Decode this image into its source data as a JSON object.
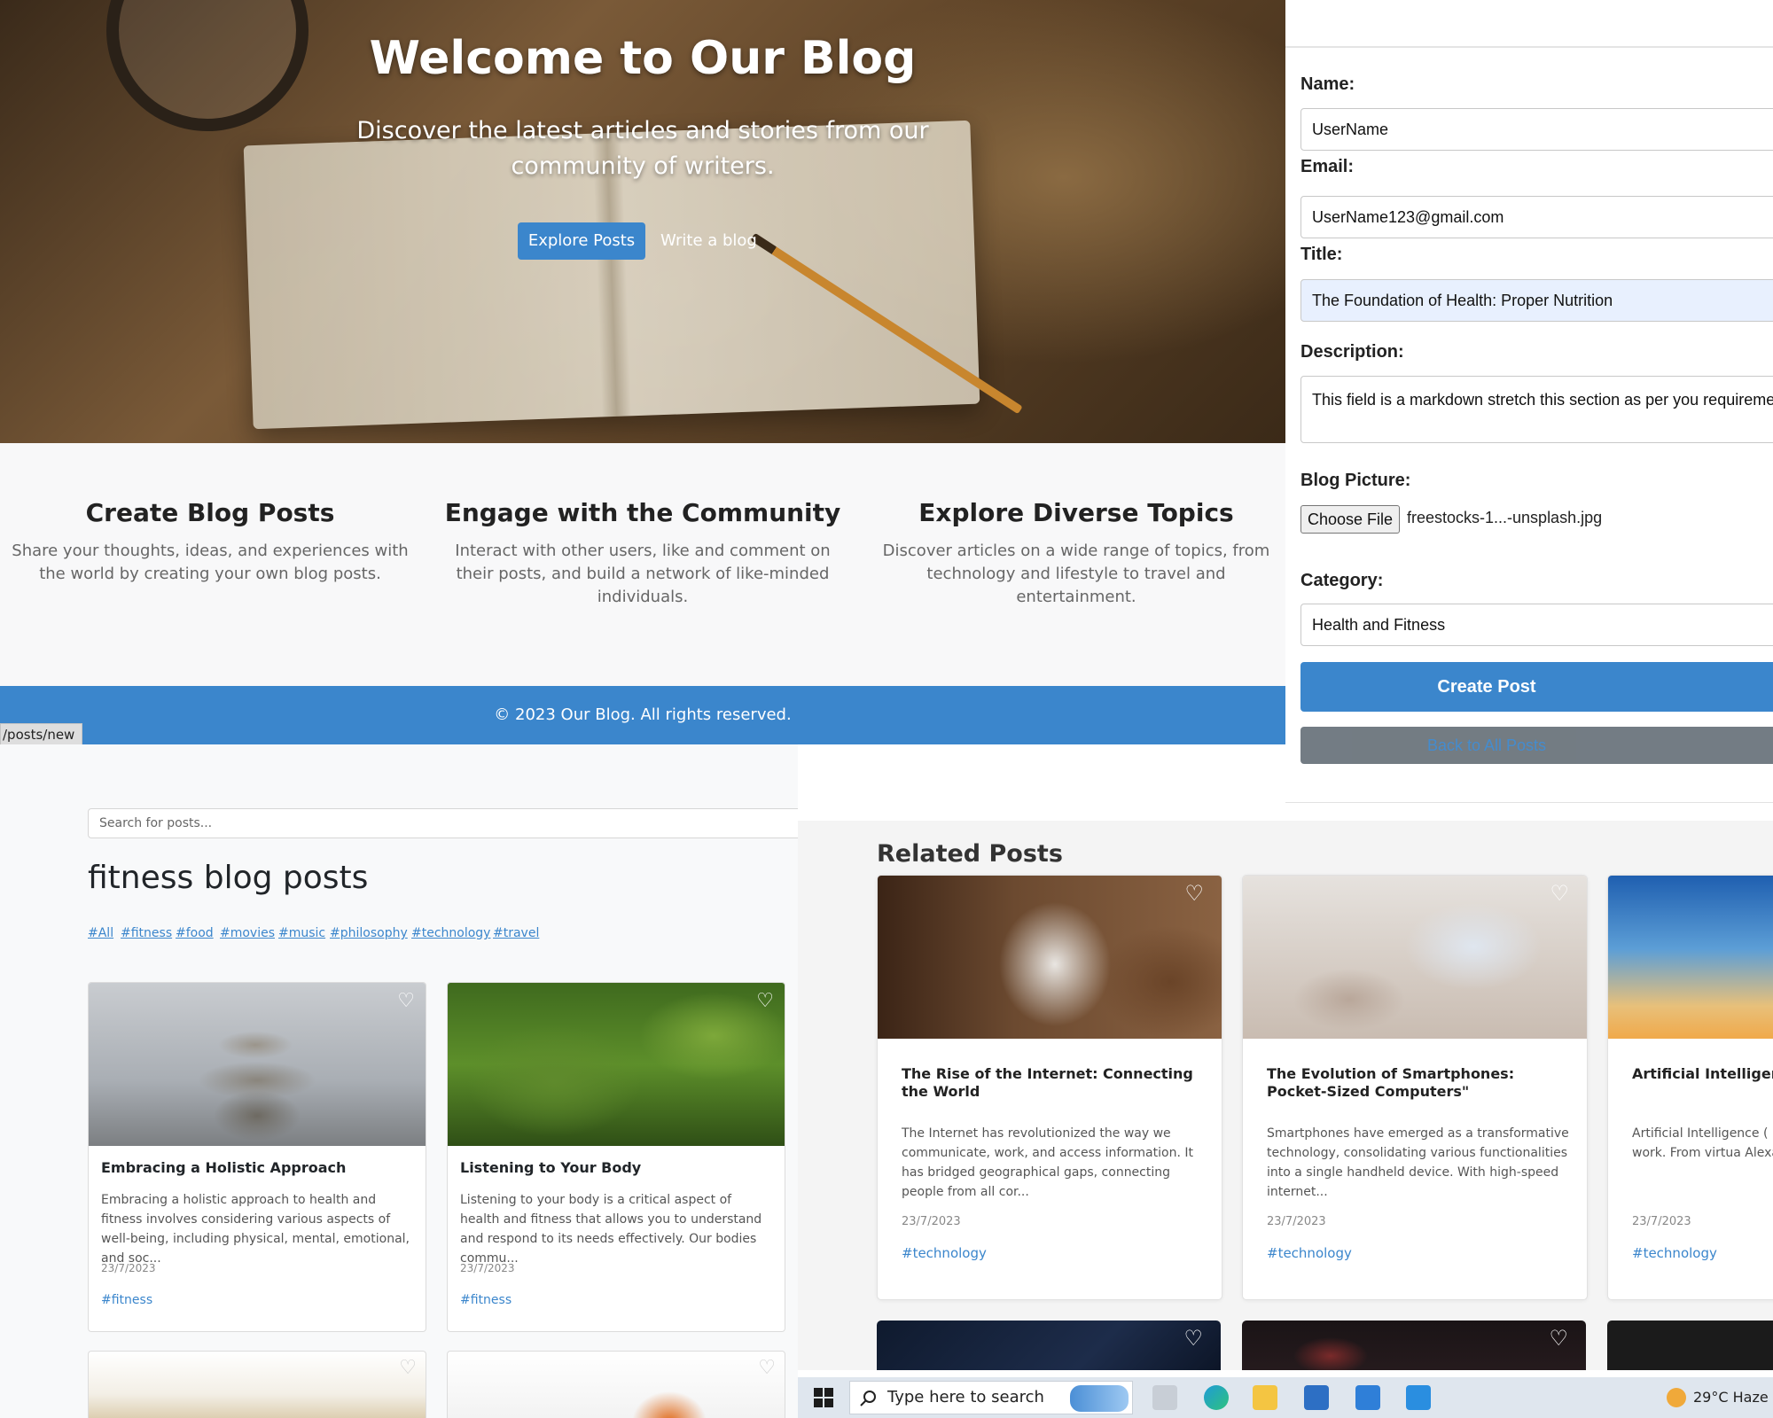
{
  "hero": {
    "title": "Welcome to Our Blog",
    "subtitle": "Discover the latest articles and stories from our community of writers.",
    "explore_btn": "Explore Posts",
    "write_link": "Write a blog"
  },
  "features": [
    {
      "title": "Create Blog Posts",
      "text": "Share your thoughts, ideas, and experiences with the world by creating your own blog posts."
    },
    {
      "title": "Engage with the Community",
      "text": "Interact with other users, like and comment on their posts, and build a network of like-minded individuals."
    },
    {
      "title": "Explore Diverse Topics",
      "text": "Discover articles on a wide range of topics, from technology and lifestyle to travel and entertainment."
    }
  ],
  "footer": {
    "text": "© 2023 Our Blog. All rights reserved."
  },
  "status_url": "/posts/new",
  "form": {
    "name_label": "Name:",
    "name_value": "UserName",
    "email_label": "Email:",
    "email_value": "UserName123@gmail.com",
    "title_label": "Title:",
    "title_value": "The Foundation of Health: Proper Nutrition",
    "description_label": "Description:",
    "description_value": "This field is a markdown stretch this section as per you requireme",
    "picture_label": "Blog Picture:",
    "choose_file": "Choose File",
    "file_name": "freestocks-1...-unsplash.jpg",
    "category_label": "Category:",
    "category_value": "Health and Fitness",
    "create_btn": "Create Post",
    "back_btn": "Back to All Posts"
  },
  "fitness": {
    "search_placeholder": "Search for posts...",
    "title": "fitness blog posts",
    "tags": [
      "#All",
      "#fitness",
      "#food",
      "#movies",
      "#music",
      "#philosophy",
      "#technology",
      "#travel"
    ],
    "posts": [
      {
        "title": "Embracing a Holistic Approach",
        "desc": "Embracing a holistic approach to health and fitness involves considering various aspects of well-being, including physical, mental, emotional, and soc...",
        "date": "23/7/2023",
        "tag": "#fitness"
      },
      {
        "title": "Listening to Your Body",
        "desc": "Listening to your body is a critical aspect of health and fitness that allows you to understand and respond to its needs effectively. Our bodies commu...",
        "date": "23/7/2023",
        "tag": "#fitness"
      }
    ]
  },
  "related": {
    "title": "Related Posts",
    "posts": [
      {
        "title": "The Rise of the Internet: Connecting the World",
        "desc": "The Internet has revolutionized the way we communicate, work, and access information. It has bridged geographical gaps, connecting people from all cor...",
        "date": "23/7/2023",
        "tag": "#technology"
      },
      {
        "title": "The Evolution of Smartphones: Pocket-Sized Computers\"",
        "desc": "Smartphones have emerged as a transformative technology, consolidating various functionalities into a single handheld device. With high-speed internet...",
        "date": "23/7/2023",
        "tag": "#technology"
      },
      {
        "title": "Artificial Intelligenc Future",
        "desc": "Artificial Intelligence ( industries and revolut and work. From virtua Alexa to self...",
        "date": "23/7/2023",
        "tag": "#technology"
      }
    ]
  },
  "taskbar": {
    "search_placeholder": "Type here to search",
    "weather": "29°C  Haze"
  },
  "colors": {
    "accent": "#3b86cc",
    "secondary": "#6c757d"
  }
}
